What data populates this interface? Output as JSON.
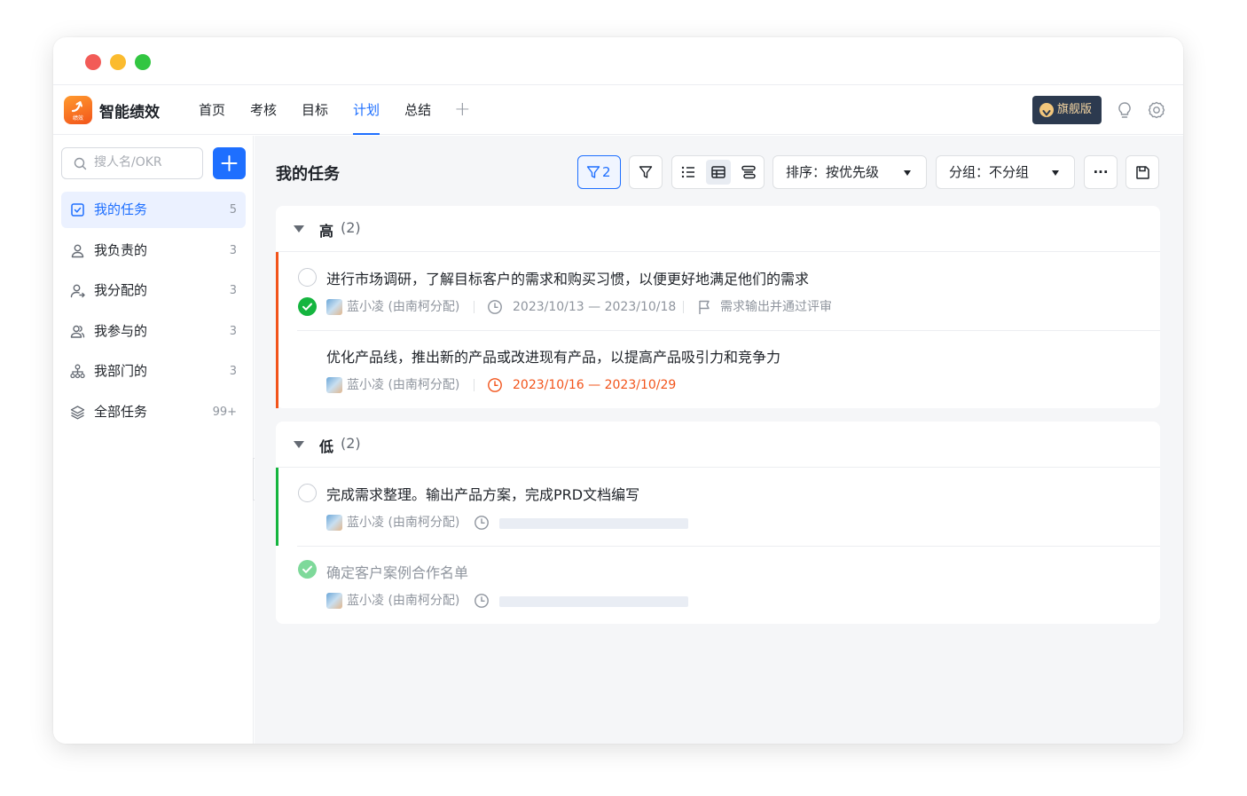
{
  "app": {
    "name": "智能绩效",
    "logo_text": "绩效"
  },
  "nav": {
    "tabs": [
      {
        "label": "首页"
      },
      {
        "label": "考核"
      },
      {
        "label": "目标"
      },
      {
        "label": "计划"
      },
      {
        "label": "总结"
      }
    ],
    "active_tab": "计划",
    "add_label": "+"
  },
  "header": {
    "vip_label": "旗舰版",
    "vip_icon": "v-badge-icon",
    "hint_icon": "lightbulb-icon",
    "settings_icon": "gear-icon"
  },
  "sidebar": {
    "search_placeholder": "搜人名/OKR",
    "add_icon": "plus-icon",
    "items": [
      {
        "label": "我的任务",
        "count": "5",
        "icon": "checkbox-icon",
        "active": true
      },
      {
        "label": "我负责的",
        "count": "3",
        "icon": "user-icon"
      },
      {
        "label": "我分配的",
        "count": "3",
        "icon": "user-assign-icon"
      },
      {
        "label": "我参与的",
        "count": "3",
        "icon": "users-icon"
      },
      {
        "label": "我部门的",
        "count": "3",
        "icon": "org-icon"
      },
      {
        "label": "全部任务",
        "count": "99+",
        "icon": "layers-icon"
      }
    ]
  },
  "main": {
    "title": "我的任务",
    "toolbar": {
      "filter_count": "2",
      "sort_label": "排序：按优先级",
      "group_label": "分组：不分组",
      "more_label": "···"
    },
    "groups": [
      {
        "name": "高",
        "count": "(2)",
        "accent": "#f2541b",
        "tasks": [
          {
            "title": "进行市场调研，了解目标客户的需求和购买习惯，以便更好地满足他们的需求",
            "assignee": "蓝小凌 (由南柯分配)",
            "date": "2023/10/13 — 2023/10/18",
            "milestone": "需求输出并通过评审",
            "done": false
          },
          {
            "title": "优化产品线，推出新的产品或改进现有产品，以提高产品吸引力和竞争力",
            "assignee": "蓝小凌 (由南柯分配)",
            "date": "2023/10/16 — 2023/10/29",
            "overdue": true
          }
        ]
      },
      {
        "name": "低",
        "count": "(2)",
        "accent": "#15b53f",
        "tasks": [
          {
            "title": "完成需求整理。输出产品方案，完成PRD文档编写",
            "assignee": "蓝小凌 (由南柯分配)",
            "done": false
          },
          {
            "title": "确定客户案例合作名单",
            "assignee": "蓝小凌 (由南柯分配)",
            "done": true
          }
        ]
      }
    ]
  },
  "colors": {
    "primary": "#1e6fff",
    "overdue": "#f2541b",
    "done": "#15b53f"
  }
}
